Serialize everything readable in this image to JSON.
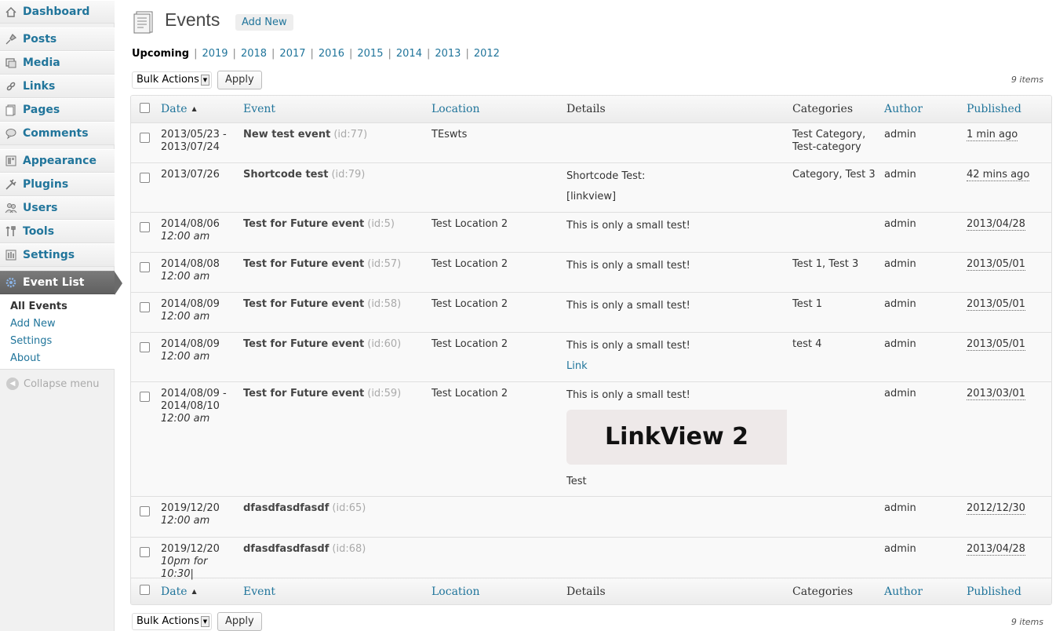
{
  "sidebar": {
    "items": [
      {
        "label": "Dashboard",
        "icon": "dashboard-icon"
      },
      {
        "label": "Posts",
        "icon": "pin-icon"
      },
      {
        "label": "Media",
        "icon": "media-icon"
      },
      {
        "label": "Links",
        "icon": "link-icon"
      },
      {
        "label": "Pages",
        "icon": "pages-icon"
      },
      {
        "label": "Comments",
        "icon": "comment-icon"
      },
      {
        "label": "Appearance",
        "icon": "appearance-icon"
      },
      {
        "label": "Plugins",
        "icon": "plugin-icon"
      },
      {
        "label": "Users",
        "icon": "users-icon"
      },
      {
        "label": "Tools",
        "icon": "tools-icon"
      },
      {
        "label": "Settings",
        "icon": "settings-icon"
      },
      {
        "label": "Event List",
        "icon": "gear-icon"
      }
    ],
    "submenu": [
      "All Events",
      "Add New",
      "Settings",
      "About"
    ],
    "collapse_label": "Collapse menu"
  },
  "header": {
    "title": "Events",
    "add_new": "Add New"
  },
  "filters": {
    "current": "Upcoming",
    "years": [
      "2019",
      "2018",
      "2017",
      "2016",
      "2015",
      "2014",
      "2013",
      "2012"
    ],
    "separator": "|"
  },
  "bulk": {
    "select_label": "Bulk Actions",
    "apply": "Apply",
    "count": "9 items"
  },
  "columns": {
    "date": "Date",
    "event": "Event",
    "location": "Location",
    "details": "Details",
    "categories": "Categories",
    "author": "Author",
    "published": "Published"
  },
  "rows": [
    {
      "date": "2013/05/23 -",
      "date2": "2013/07/24",
      "time": "",
      "title": "New test event",
      "id": "(id:77)",
      "location": "TEswts",
      "details": [],
      "categories": "Test Category, Test-category",
      "author": "admin",
      "published": "1 min ago"
    },
    {
      "date": "2013/07/26",
      "date2": "",
      "time": "",
      "title": "Shortcode test",
      "id": "(id:79)",
      "location": "",
      "details": [
        "Shortcode Test:",
        "[linkview]"
      ],
      "categories": "Category, Test 3",
      "author": "admin",
      "published": "42 mins ago"
    },
    {
      "date": "2014/08/06",
      "date2": "",
      "time": "12:00 am",
      "title": "Test for Future event",
      "id": "(id:5)",
      "location": "Test Location 2",
      "details": [
        "This is only a small test!"
      ],
      "categories": "",
      "author": "admin",
      "published": "2013/04/28"
    },
    {
      "date": "2014/08/08",
      "date2": "",
      "time": "12:00 am",
      "title": "Test for Future event",
      "id": "(id:57)",
      "location": "Test Location 2",
      "details": [
        "This is only a small test!"
      ],
      "categories": "Test 1, Test 3",
      "author": "admin",
      "published": "2013/05/01"
    },
    {
      "date": "2014/08/09",
      "date2": "",
      "time": "12:00 am",
      "title": "Test for Future event",
      "id": "(id:58)",
      "location": "Test Location 2",
      "details": [
        "This is only a small test!"
      ],
      "categories": "Test 1",
      "author": "admin",
      "published": "2013/05/01"
    },
    {
      "date": "2014/08/09",
      "date2": "",
      "time": "12:00 am",
      "title": "Test for Future event",
      "id": "(id:60)",
      "location": "Test Location 2",
      "details": [
        "This is only a small test!"
      ],
      "detail_link": "Link",
      "categories": "test 4",
      "author": "admin",
      "published": "2013/05/01"
    },
    {
      "date": "2014/08/09 -",
      "date2": "2014/08/10",
      "time": "12:00 am",
      "title": "Test for Future event",
      "id": "(id:59)",
      "location": "Test Location 2",
      "details": [
        "This is only a small test!"
      ],
      "linkview": "LinkView 2",
      "details_after": "Test",
      "categories": "",
      "author": "admin",
      "published": "2013/03/01"
    },
    {
      "date": "2019/12/20",
      "date2": "",
      "time": "12:00 am",
      "title": "dfasdfasdfasdf",
      "id": "(id:65)",
      "location": "",
      "details": [],
      "categories": "",
      "author": "admin",
      "published": "2012/12/30"
    },
    {
      "date": "2019/12/20",
      "date2": "",
      "time": "10pm for 10:30|",
      "title": "dfasdfasdfasdf",
      "id": "(id:68)",
      "location": "",
      "details": [],
      "categories": "",
      "author": "admin",
      "published": "2013/04/28"
    }
  ]
}
